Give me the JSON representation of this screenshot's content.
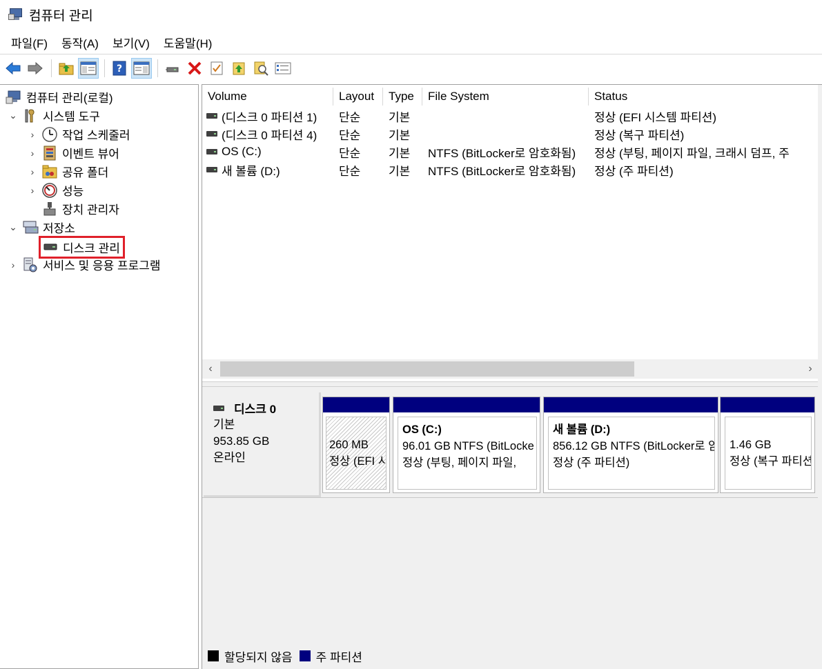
{
  "window": {
    "title": "컴퓨터 관리"
  },
  "menu": [
    "파일(F)",
    "동작(A)",
    "보기(V)",
    "도움말(H)"
  ],
  "toolbar": {
    "buttons": [
      "back-icon",
      "forward-icon",
      "up-folder-icon",
      "show-hide-tree-icon",
      "help-icon",
      "show-action-pane-icon",
      "connect-icon",
      "delete-icon",
      "properties-icon",
      "rescan-icon",
      "search-icon",
      "list-icon"
    ]
  },
  "tree": {
    "root": "컴퓨터 관리(로컬)",
    "system_tools": "시스템 도구",
    "task_scheduler": "작업 스케줄러",
    "event_viewer": "이벤트 뷰어",
    "shared_folders": "공유 폴더",
    "performance": "성능",
    "device_manager": "장치 관리자",
    "storage": "저장소",
    "disk_management": "디스크 관리",
    "services_apps": "서비스 및 응용 프로그램"
  },
  "volume_list": {
    "columns": [
      "Volume",
      "Layout",
      "Type",
      "File System",
      "Status"
    ],
    "rows": [
      {
        "volume": "(디스크 0 파티션 1)",
        "layout": "단순",
        "type": "기본",
        "fs": "",
        "status": "정상 (EFI 시스템 파티션)"
      },
      {
        "volume": "(디스크 0 파티션 4)",
        "layout": "단순",
        "type": "기본",
        "fs": "",
        "status": "정상 (복구 파티션)"
      },
      {
        "volume": "OS (C:)",
        "layout": "단순",
        "type": "기본",
        "fs": "NTFS (BitLocker로 암호화됨)",
        "status": "정상 (부팅, 페이지 파일, 크래시 덤프, 주"
      },
      {
        "volume": "새 볼륨 (D:)",
        "layout": "단순",
        "type": "기본",
        "fs": "NTFS (BitLocker로 암호화됨)",
        "status": "정상 (주 파티션)"
      }
    ]
  },
  "disk": {
    "name": "디스크 0",
    "kind": "기본",
    "size": "953.85 GB",
    "state": "온라인",
    "partitions": [
      {
        "title": "",
        "line1": "260 MB",
        "line2": "정상 (EFI 시"
      },
      {
        "title": "OS  (C:)",
        "line1": "96.01 GB NTFS (BitLocke",
        "line2": "정상 (부팅, 페이지 파일, "
      },
      {
        "title": "새 볼륨  (D:)",
        "line1": "856.12 GB NTFS (BitLocker로 암",
        "line2": "정상 (주 파티션)"
      },
      {
        "title": "",
        "line1": "1.46 GB",
        "line2": "정상 (복구 파티션)"
      }
    ]
  },
  "legend": {
    "unallocated": "할당되지 않음",
    "primary": "주 파티션"
  },
  "colors": {
    "primary_partition": "#00007f",
    "unallocated": "#000000",
    "selection_highlight": "#e0202a"
  }
}
